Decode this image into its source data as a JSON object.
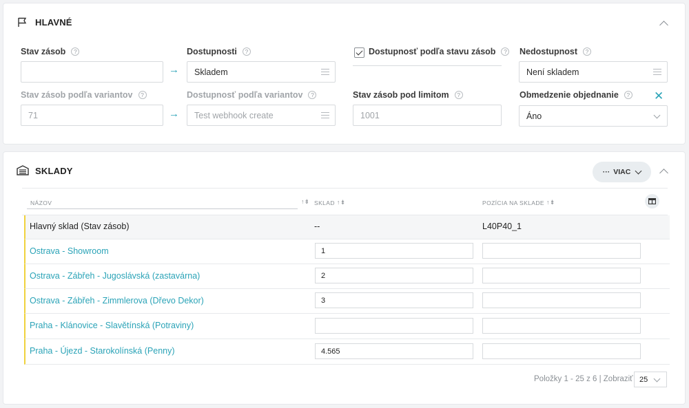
{
  "main": {
    "title": "HLAVNÉ",
    "stock_label": "Stav zásob",
    "stock_value": "",
    "availability_label": "Dostupnosti",
    "availability_value": "Skladem",
    "avail_by_stock_label": "Dostupnosť podľa stavu zásob",
    "avail_by_stock_checked": true,
    "unavailability_label": "Nedostupnost",
    "unavailability_value": "Není skladem",
    "variant_stock_label": "Stav zásob podľa variantov",
    "variant_stock_value": "71",
    "variant_avail_label": "Dostupnosť podľa variantov",
    "variant_avail_value": "Test webhook create",
    "stock_limit_label": "Stav zásob pod limitom",
    "stock_limit_value": "1001",
    "order_limit_label": "Obmedzenie objednanie",
    "order_limit_value": "Áno",
    "help_glyph": "?",
    "arrow_glyph": "→",
    "close_glyph": "✕"
  },
  "stock": {
    "title": "SKLADY",
    "more_label": "VIAC",
    "more_dots": "···",
    "columns": {
      "name": "NÁZOV",
      "warehouse": "SKLAD",
      "position": "POZÍCIA NA SKLADE"
    },
    "sort_glyph": "↑⇟",
    "rows": [
      {
        "name": "Hlavný sklad (Stav zásob)",
        "warehouse": "--",
        "position": "L40P40_1"
      },
      {
        "name": "Ostrava - Showroom",
        "warehouse": "1",
        "position": ""
      },
      {
        "name": "Ostrava - Zábřeh - Jugoslávská (zastavárna)",
        "warehouse": "2",
        "position": ""
      },
      {
        "name": "Ostrava - Zábřeh - Zimmlerova (Dřevo Dekor)",
        "warehouse": "3",
        "position": ""
      },
      {
        "name": "Praha - Klánovice - Slavětínská (Potraviny)",
        "warehouse": "",
        "position": ""
      },
      {
        "name": "Praha - Újezd - Starokolínská (Penny)",
        "warehouse": "4.565",
        "position": ""
      }
    ],
    "pager_text": "Položky 1 - 25 z 6 | Zobraziť",
    "page_size": "25"
  },
  "colors": {
    "accent": "#2aa3b7",
    "row_marker": "#f0d23c"
  }
}
